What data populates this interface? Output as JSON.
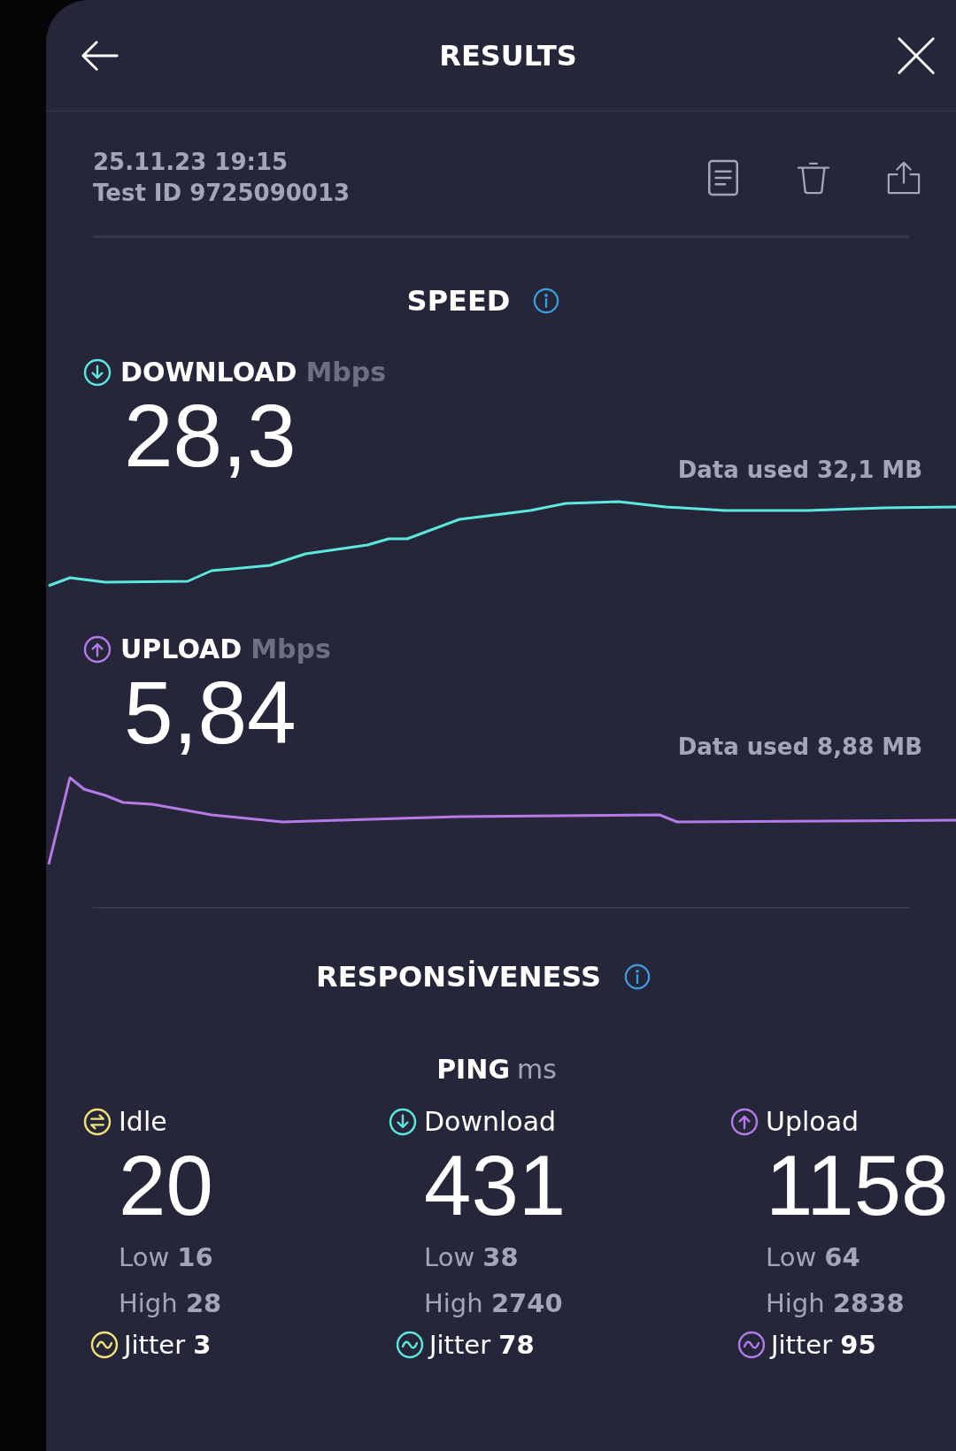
{
  "header": {
    "title": "RESULTS"
  },
  "test": {
    "date": "25.11.23 19:15",
    "test_id": "Test ID 9725090013"
  },
  "speed": {
    "title": "SPEED",
    "metrics": [
      {
        "kind": "download",
        "label": "DOWNLOAD",
        "unit": "Mbps",
        "value": "28,3",
        "data_used": "Data used 32,1 MB"
      },
      {
        "kind": "upload",
        "label": "UPLOAD",
        "unit": "Mbps",
        "value": "5,84",
        "data_used": "Data used 8,88 MB"
      }
    ]
  },
  "responsiveness": {
    "title": "RESPONSİVENESS",
    "ping": {
      "label": "PING",
      "unit": "ms",
      "columns": [
        {
          "kind": "idle",
          "label": "Idle",
          "value": "20",
          "low": "Low **16**",
          "high": "High **28**",
          "jitter": "Jitter **3**"
        },
        {
          "kind": "download",
          "label": "Download",
          "value": "431",
          "low": "Low **38**",
          "high": "High **2740**",
          "jitter": "Jitter **78**"
        },
        {
          "kind": "upload",
          "label": "Upload",
          "value": "1158",
          "low": "Low **64**",
          "high": "High **2838**",
          "jitter": "Jitter **95**"
        }
      ]
    }
  }
}
